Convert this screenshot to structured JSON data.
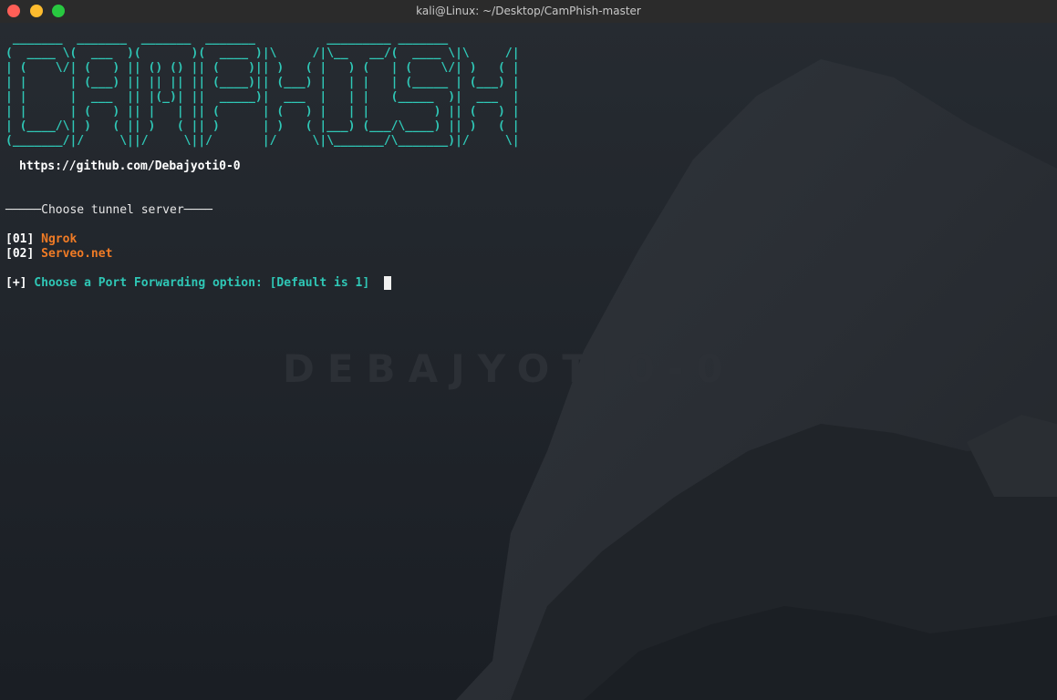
{
  "window": {
    "title": "kali@Linux: ~/Desktop/CamPhish-master"
  },
  "background": {
    "watermark_text": "DEBAJYOTI0-0"
  },
  "terminal": {
    "banner": " _______  _______  _______  _______          _________ _______          \n(  ____ \\(  ___  )(       )(  ____ )|\\     /|\\__   __/(  ____ \\|\\     /|\n| (    \\/| (   ) || () () || (    )|| )   ( |   ) (   | (    \\/| )   ( |\n| |      | (___) || || || || (____)|| (___) |   | |   | (_____ | (___) |\n| |      |  ___  || |(_)| ||  _____)|  ___  |   | |   (_____  )|  ___  |\n| |      | (   ) || |   | || (      | (   ) |   | |         ) || (   ) |\n| (____/\\| )   ( || )   ( || )      | )   ( |___) (___/\\____) || )   ( |\n(_______/|/     \\||/     \\||/       |/     \\|\\_______/\\_______)|/     \\|",
    "url": "https://github.com/Debajyoti0-0",
    "section_title": "─────Choose tunnel server────",
    "options": [
      {
        "number": "[01]",
        "label": "Ngrok"
      },
      {
        "number": "[02]",
        "label": "Serveo.net"
      }
    ],
    "prompt_prefix": "[+]",
    "prompt_text": " Choose a Port Forwarding option: [Default is 1] "
  },
  "colors": {
    "accent_cyan": "#2fc7b6",
    "option_orange": "#f07b25",
    "background": "#1c2027"
  }
}
